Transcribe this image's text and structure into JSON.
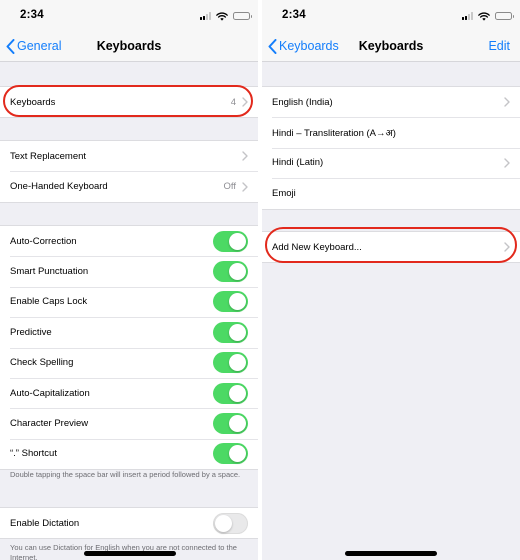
{
  "colors": {
    "accent": "#147efb",
    "toggle_on": "#4cd964",
    "highlight": "#e2291c"
  },
  "left": {
    "status_time": "2:34",
    "nav": {
      "back_label": "General",
      "title": "Keyboards"
    },
    "keyboards_row": {
      "label": "Keyboards",
      "value": "4"
    },
    "group2": [
      {
        "label": "Text Replacement",
        "value": ""
      },
      {
        "label": "One-Handed Keyboard",
        "value": "Off"
      }
    ],
    "toggles": [
      {
        "label": "Auto-Correction",
        "on": true
      },
      {
        "label": "Smart Punctuation",
        "on": true
      },
      {
        "label": "Enable Caps Lock",
        "on": true
      },
      {
        "label": "Predictive",
        "on": true
      },
      {
        "label": "Check Spelling",
        "on": true
      },
      {
        "label": "Auto-Capitalization",
        "on": true
      },
      {
        "label": "Character Preview",
        "on": true
      },
      {
        "label": "“.” Shortcut",
        "on": true
      }
    ],
    "shortcut_note": "Double tapping the space bar will insert a period followed by a space.",
    "dictation": {
      "label": "Enable Dictation",
      "on": false
    },
    "dictation_note": "You can use Dictation for English when you are not connected to the Internet."
  },
  "right": {
    "status_time": "2:34",
    "nav": {
      "back_label": "Keyboards",
      "title": "Keyboards",
      "action_label": "Edit"
    },
    "keyboards": [
      {
        "label": "English (India)",
        "chevron": true
      },
      {
        "label": "Hindi – Transliteration (A→अ)",
        "chevron": false
      },
      {
        "label": "Hindi (Latin)",
        "chevron": true
      },
      {
        "label": "Emoji",
        "chevron": false
      }
    ],
    "add_keyboard": {
      "label": "Add New Keyboard..."
    }
  }
}
